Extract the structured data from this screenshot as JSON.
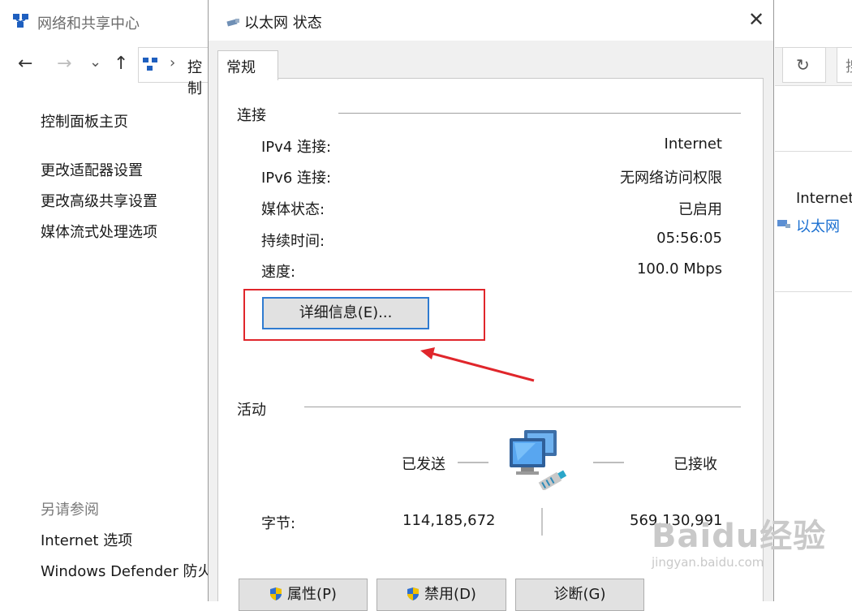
{
  "background_window": {
    "title": "网络和共享中心",
    "nav": {
      "back_icon": "←",
      "forward_icon": "→",
      "dropdown_icon": "⌄",
      "up_icon": "↑",
      "chevron": "›",
      "path": "控制",
      "refresh_icon": "↻",
      "search_text": "搜"
    },
    "sidebar": {
      "home": "控制面板主页",
      "links": [
        "更改适配器设置",
        "更改高级共享设置",
        "媒体流式处理选项"
      ],
      "see_also_title": "另请参阅",
      "see_also_links": [
        "Internet 选项",
        "Windows Defender 防火"
      ]
    },
    "right": {
      "internet_label": "Internet",
      "ethernet_link": "以太网"
    }
  },
  "dialog": {
    "title": "以太网 状态",
    "close_icon": "✕",
    "tab": "常规",
    "connection": {
      "header": "连接",
      "rows": [
        {
          "label": "IPv4 连接:",
          "value": "Internet"
        },
        {
          "label": "IPv6 连接:",
          "value": "无网络访问权限"
        },
        {
          "label": "媒体状态:",
          "value": "已启用"
        },
        {
          "label": "持续时间:",
          "value": "05:56:05"
        },
        {
          "label": "速度:",
          "value": "100.0 Mbps"
        }
      ],
      "details_button": "详细信息(E)..."
    },
    "activity": {
      "header": "活动",
      "sent_label": "已发送",
      "received_label": "已接收",
      "bytes_label": "字节:",
      "bytes_sent": "114,185,672",
      "bytes_received": "569,130,991"
    },
    "buttons": {
      "properties": "属性(P)",
      "disable": "禁用(D)",
      "diagnose": "诊断(G)"
    }
  },
  "annotation": {
    "highlight_color": "#e0262b"
  },
  "watermark": {
    "main": "Baidu经验",
    "url": "jingyan.baidu.com"
  },
  "colors": {
    "accent_blue": "#2f7bd0",
    "link_blue": "#1a6fd1"
  }
}
